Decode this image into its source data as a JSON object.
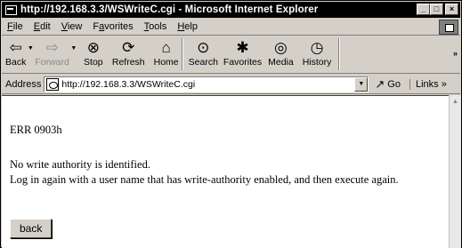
{
  "window": {
    "title": "http://192.168.3.3/WSWriteC.cgi - Microsoft Internet Explorer",
    "minimize": "_",
    "maximize": "□",
    "close": "×"
  },
  "menu": [
    {
      "key": "file",
      "underline": "F",
      "rest": "ile"
    },
    {
      "key": "edit",
      "underline": "E",
      "rest": "dit"
    },
    {
      "key": "view",
      "underline": "V",
      "rest": "iew"
    },
    {
      "key": "favorites",
      "pre": "F",
      "underline": "a",
      "rest": "vorites"
    },
    {
      "key": "tools",
      "underline": "T",
      "rest": "ools"
    },
    {
      "key": "help",
      "underline": "H",
      "rest": "elp"
    }
  ],
  "toolbar": {
    "back": "Back",
    "forward": "Forward",
    "stop": "Stop",
    "refresh": "Refresh",
    "home": "Home",
    "search": "Search",
    "favorites": "Favorites",
    "media": "Media",
    "history": "History"
  },
  "address": {
    "label": "Address",
    "url": "http://192.168.3.3/WSWriteC.cgi",
    "go": "Go",
    "links": "Links"
  },
  "page": {
    "error_code": "ERR 0903h",
    "line1": "No write authority is identified.",
    "line2": "Log in again with a user name that has write-authority enabled, and then execute again.",
    "back_button": "back"
  }
}
